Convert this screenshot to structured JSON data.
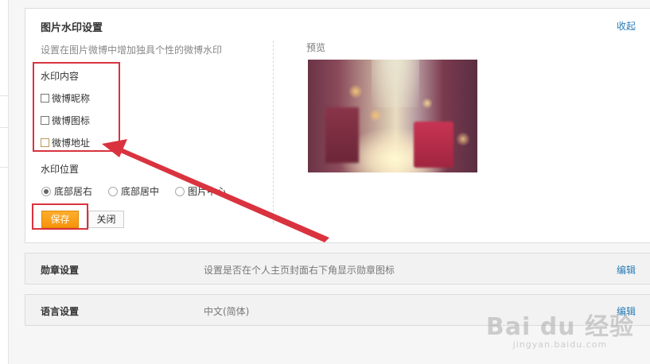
{
  "watermark_panel": {
    "title": "图片水印设置",
    "collapse_label": "收起",
    "description": "设置在图片微博中增加独具个性的微博水印",
    "content_heading": "水印内容",
    "options": [
      {
        "label": "微博昵称",
        "checked": false
      },
      {
        "label": "微博图标",
        "checked": false
      },
      {
        "label": "微博地址",
        "checked": false
      }
    ],
    "position_heading": "水印位置",
    "positions": [
      {
        "label": "底部居右",
        "selected": true
      },
      {
        "label": "底部居中",
        "selected": false
      },
      {
        "label": "图片中心",
        "selected": false
      }
    ],
    "save_label": "保存",
    "close_label": "关闭",
    "preview_label": "预览"
  },
  "medal_section": {
    "title": "勋章设置",
    "description": "设置是否在个人主页封面右下角显示勋章图标",
    "edit_label": "编辑"
  },
  "language_section": {
    "title": "语言设置",
    "value": "中文(简体)",
    "edit_label": "编辑"
  },
  "watermark_logo": {
    "brand": "Bai du 经验",
    "url": "jingyan.baidu.com"
  },
  "colors": {
    "link": "#2a7cb4",
    "save_button": "#f6930a",
    "highlight": "#d9333f"
  }
}
